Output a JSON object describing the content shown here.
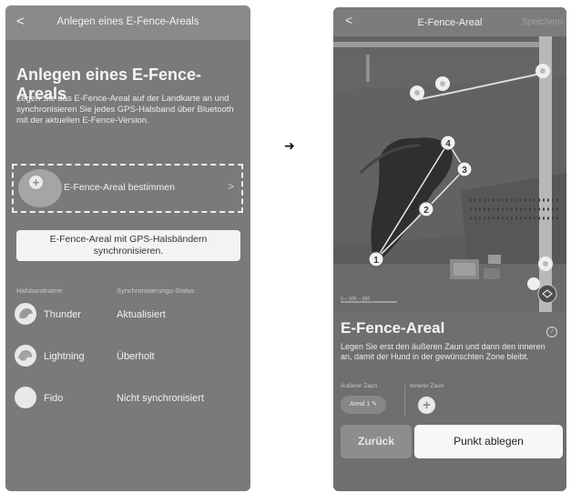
{
  "left_screen": {
    "header": {
      "back_symbol": "<",
      "title": "Anlegen eines E-Fence-Areals"
    },
    "heading": "Anlegen eines E-Fence-Areals",
    "description": "Legen Sie das E-Fence-Areal auf der Landkarte an und synchronisieren Sie jedes GPS-Halsband über Bluetooth mit der aktuellen E-Fence-Version.",
    "define_area": {
      "icon": "plus-icon",
      "plus_symbol": "+",
      "label": "E-Fence-Areal bestimmen",
      "chevron": ">"
    },
    "sync_button": "E-Fence-Areal mit GPS-Halsbändern synchronisieren.",
    "columns": {
      "name": "Halsbandname",
      "status": "Synchronisierungs-Status"
    },
    "collars": [
      {
        "name": "Thunder",
        "status": "Aktualisiert"
      },
      {
        "name": "Lightning",
        "status": "Überholt"
      },
      {
        "name": "Fido",
        "status": "Nicht synchronisiert"
      }
    ]
  },
  "arrow_symbol": "➜",
  "right_screen": {
    "header": {
      "back_symbol": "<",
      "title": "E-Fence-Areal",
      "save": "Speichern"
    },
    "map": {
      "points": [
        "1",
        "2",
        "3",
        "4"
      ],
      "scale_label": "0 ─ 500 ─ 600"
    },
    "sheet": {
      "heading": "E-Fence-Areal",
      "info_symbol": "i",
      "description": "Legen Sie erst den äußeren Zaun und dann den inneren an, damit der Hund in der gewünschten Zone bleibt.",
      "outer_fence_label": "Äußerer Zaun",
      "inner_fence_label": "Innerer Zaun",
      "outer_area_pill": "Areal 1 ✎",
      "add_symbol": "+",
      "back_button": "Zurück",
      "place_point_button": "Punkt ablegen"
    }
  }
}
